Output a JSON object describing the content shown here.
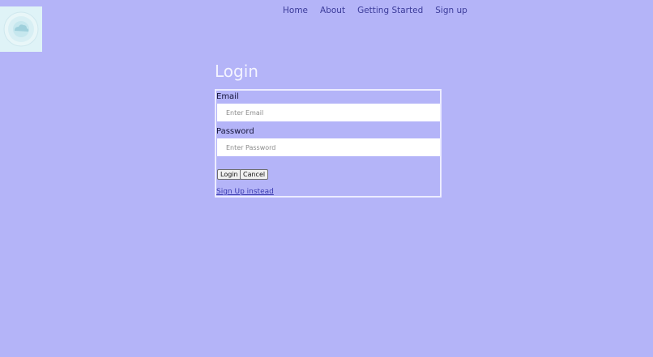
{
  "logo": {
    "icon": "cloud-logo-icon"
  },
  "nav": {
    "items": [
      {
        "label": "Home"
      },
      {
        "label": "About"
      },
      {
        "label": "Getting Started"
      },
      {
        "label": "Sign up"
      }
    ]
  },
  "login": {
    "title": "Login",
    "email_label": "Email",
    "email_placeholder": "Enter Email",
    "email_value": "",
    "password_label": "Password",
    "password_placeholder": "Enter Password",
    "password_value": "",
    "login_button": "Login",
    "cancel_button": "Cancel",
    "signup_link": "Sign Up instead"
  },
  "colors": {
    "background": "#b4b4f8",
    "nav_text": "#3c3c9a",
    "title_text": "#f4f4ff",
    "form_border": "#ececff",
    "link": "#3b3bb0"
  }
}
